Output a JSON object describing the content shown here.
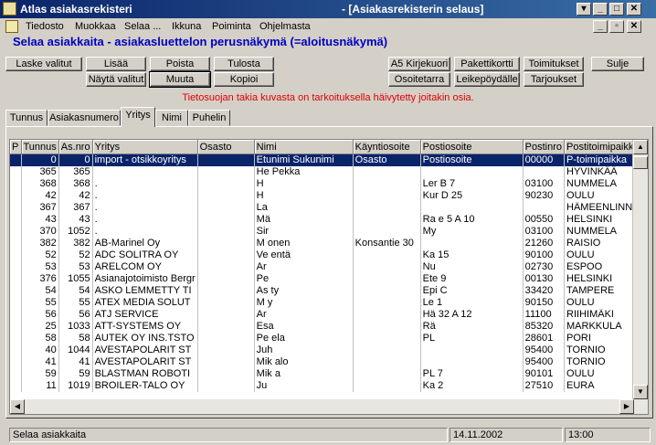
{
  "window": {
    "app_title": "Atlas asiakasrekisteri",
    "doc_title": "- [Asiakasrekisterin selaus]"
  },
  "menu": {
    "items": [
      "Tiedosto",
      "Muokkaa",
      "Selaa ...",
      "Ikkuna",
      "Poiminta",
      "Ohjelmasta"
    ]
  },
  "heading": "Selaa asiakkaita - asiakasluettelon perusnäkymä (=aloitusnäkymä)",
  "toolbar": {
    "laske_valitut": "Laske valitut",
    "lisaa": "Lisää",
    "poista": "Poista",
    "tulosta": "Tulosta",
    "nayta_valitut": "Näytä valitut",
    "muuta": "Muuta",
    "kopioi": "Kopioi",
    "a5_kirjekuori": "A5 Kirjekuori",
    "pakettikortti": "Pakettikortti",
    "toimitukset": "Toimitukset",
    "sulje": "Sulje",
    "osoitetarra": "Osoitetarra",
    "leikepoydalle": "Leikepöydälle",
    "tarjoukset": "Tarjoukset"
  },
  "notice": "Tietosuojan takia kuvasta on tarkoituksella häivytetty joitakin osia.",
  "tabs": [
    "Tunnus",
    "Asiakasnumero",
    "Yritys",
    "Nimi",
    "Puhelin"
  ],
  "active_tab": "Yritys",
  "table": {
    "columns": [
      "P",
      "Tunnus",
      "As.nro",
      "Yritys",
      "Osasto",
      "Nimi",
      "Käyntiosoite",
      "Postiosoite",
      "Postinro",
      "Postitoimipaikka"
    ],
    "rows": [
      {
        "p": "",
        "tunnus": "0",
        "asnro": "0",
        "yritys": "import - otsikkoyritys",
        "osasto": "",
        "nimi": "Etunimi Sukunimi",
        "kaynti": "Osasto",
        "posti": "Postiosoite",
        "postinro": "00000",
        "paikka": "P-toimipaikka"
      },
      {
        "p": "",
        "tunnus": "365",
        "asnro": "365",
        "yritys": "",
        "osasto": "",
        "nimi": "He    Pekka",
        "kaynti": "",
        "posti": "",
        "postinro": "",
        "paikka": "HYVINKÄÄ"
      },
      {
        "p": "",
        "tunnus": "368",
        "asnro": "368",
        "yritys": ".",
        "osasto": "",
        "nimi": "H",
        "kaynti": "",
        "posti": "Ler      B 7",
        "postinro": "03100",
        "paikka": "NUMMELA"
      },
      {
        "p": "",
        "tunnus": "42",
        "asnro": "42",
        "yritys": ".",
        "osasto": "",
        "nimi": "H",
        "kaynti": "",
        "posti": "Kur      D 25",
        "postinro": "90230",
        "paikka": "OULU"
      },
      {
        "p": "",
        "tunnus": "367",
        "asnro": "367",
        "yritys": ".",
        "osasto": "",
        "nimi": "La",
        "kaynti": "",
        "posti": "",
        "postinro": "",
        "paikka": "HÄMEENLINNA"
      },
      {
        "p": "",
        "tunnus": "43",
        "asnro": "43",
        "yritys": ".",
        "osasto": "",
        "nimi": "Mä",
        "kaynti": "",
        "posti": "Ra       e 5 A 10",
        "postinro": "00550",
        "paikka": "HELSINKI"
      },
      {
        "p": "",
        "tunnus": "370",
        "asnro": "1052",
        "yritys": ".",
        "osasto": "",
        "nimi": "Sir",
        "kaynti": "",
        "posti": "My",
        "postinro": "03100",
        "paikka": "NUMMELA"
      },
      {
        "p": "",
        "tunnus": "382",
        "asnro": "382",
        "yritys": "AB-Marinel Oy",
        "osasto": "",
        "nimi": "M       onen",
        "kaynti": "Konsantie 30",
        "posti": "",
        "postinro": "21260",
        "paikka": "RAISIO"
      },
      {
        "p": "",
        "tunnus": "52",
        "asnro": "52",
        "yritys": "ADC SOLITRA OY",
        "osasto": "",
        "nimi": "Ve      entä",
        "kaynti": "",
        "posti": "Ka      15",
        "postinro": "90100",
        "paikka": "OULU"
      },
      {
        "p": "",
        "tunnus": "53",
        "asnro": "53",
        "yritys": "ARELCOM OY",
        "osasto": "",
        "nimi": "Ar",
        "kaynti": "",
        "posti": "Nu",
        "postinro": "02730",
        "paikka": "ESPOO"
      },
      {
        "p": "",
        "tunnus": "376",
        "asnro": "1055",
        "yritys": "Asianajotoimisto Bergr",
        "osasto": "",
        "nimi": "Pe",
        "kaynti": "",
        "posti": "Ete      9",
        "postinro": "00130",
        "paikka": "HELSINKI"
      },
      {
        "p": "",
        "tunnus": "54",
        "asnro": "54",
        "yritys": "ASKO LEMMETTY TI",
        "osasto": "",
        "nimi": "As       ty",
        "kaynti": "",
        "posti": "Epi      C",
        "postinro": "33420",
        "paikka": "TAMPERE"
      },
      {
        "p": "",
        "tunnus": "55",
        "asnro": "55",
        "yritys": "ATEX MEDIA SOLUT",
        "osasto": "",
        "nimi": "M       y",
        "kaynti": "",
        "posti": "Le      1",
        "postinro": "90150",
        "paikka": "OULU"
      },
      {
        "p": "",
        "tunnus": "56",
        "asnro": "56",
        "yritys": "ATJ SERVICE",
        "osasto": "",
        "nimi": "Ar",
        "kaynti": "",
        "posti": "Hä      32 A 12",
        "postinro": "11100",
        "paikka": "RIIHIMÄKI"
      },
      {
        "p": "",
        "tunnus": "25",
        "asnro": "1033",
        "yritys": "ATT-SYSTEMS OY",
        "osasto": "",
        "nimi": "Esa",
        "kaynti": "",
        "posti": "Rä",
        "postinro": "85320",
        "paikka": "MARKKULA"
      },
      {
        "p": "",
        "tunnus": "58",
        "asnro": "58",
        "yritys": "AUTEK OY INS.TSTO",
        "osasto": "",
        "nimi": "Pe      ela",
        "kaynti": "",
        "posti": "PL",
        "postinro": "28601",
        "paikka": "PORI"
      },
      {
        "p": "",
        "tunnus": "40",
        "asnro": "1044",
        "yritys": "AVESTAPOLARIT ST",
        "osasto": "",
        "nimi": "Juh",
        "kaynti": "",
        "posti": "",
        "postinro": "95400",
        "paikka": "TORNIO"
      },
      {
        "p": "",
        "tunnus": "41",
        "asnro": "41",
        "yritys": "AVESTAPOLARIT ST",
        "osasto": "",
        "nimi": "Mik      alo",
        "kaynti": "",
        "posti": "",
        "postinro": "95400",
        "paikka": "TORNIO"
      },
      {
        "p": "",
        "tunnus": "59",
        "asnro": "59",
        "yritys": "BLASTMAN ROBOTI",
        "osasto": "",
        "nimi": "Mik      a",
        "kaynti": "",
        "posti": "PL   7",
        "postinro": "90101",
        "paikka": "OULU"
      },
      {
        "p": "",
        "tunnus": "11",
        "asnro": "1019",
        "yritys": "BROILER-TALO OY",
        "osasto": "",
        "nimi": "Ju",
        "kaynti": "",
        "posti": "Ka      2",
        "postinro": "27510",
        "paikka": "EURA"
      }
    ]
  },
  "status": {
    "text": "Selaa asiakkaita",
    "date": "14.11.2002",
    "time": "13:00"
  }
}
